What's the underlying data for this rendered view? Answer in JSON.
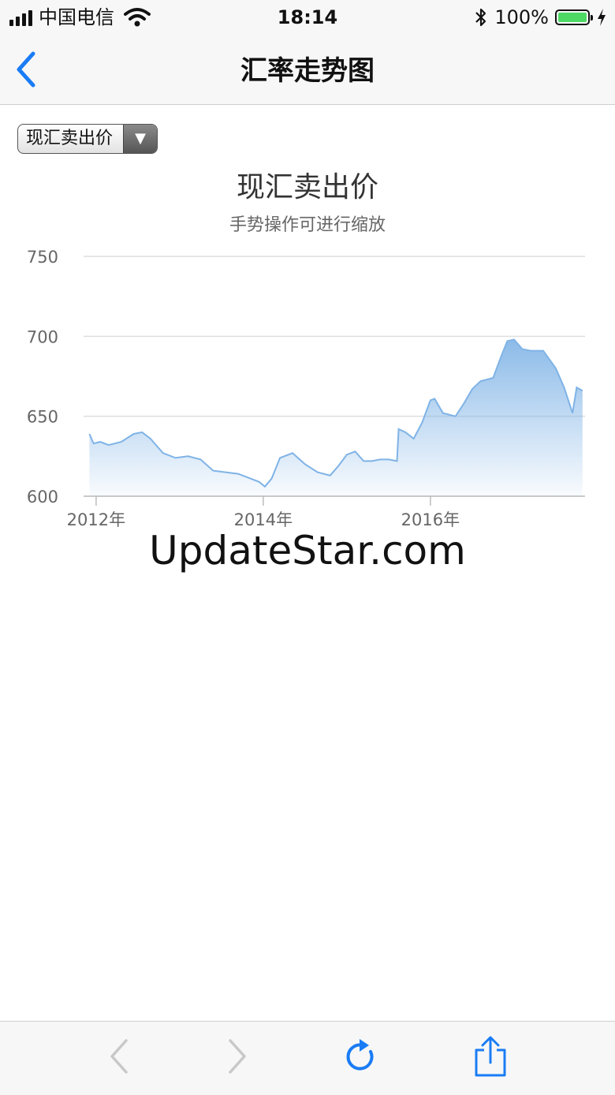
{
  "status_bar": {
    "carrier": "中国电信",
    "time": "18:14",
    "battery_percent": "100%",
    "battery_level": 1.0,
    "icons": [
      "signal-icon",
      "wifi-icon",
      "bluetooth-icon",
      "battery-icon",
      "charging-icon"
    ]
  },
  "nav": {
    "title": "汇率走势图",
    "back_icon": "chevron-left-icon",
    "accent": "#1a7cf5"
  },
  "dropdown": {
    "selected": "现汇卖出价",
    "arrow": "▼"
  },
  "chart_data": {
    "type": "area",
    "title": "现汇卖出价",
    "subtitle": "手势操作可进行缩放",
    "ylim": [
      600,
      750
    ],
    "yticks": [
      600,
      650,
      700,
      750
    ],
    "ytick_labels": [
      "600",
      "650",
      "700",
      "750"
    ],
    "xlim": [
      2011.85,
      2017.85
    ],
    "xticks": [
      2012,
      2014,
      2016
    ],
    "xtick_labels": [
      "2012年",
      "2014年",
      "2016年"
    ],
    "grid": true,
    "color": "#7fb3e6",
    "series": [
      {
        "x": [
          2011.92,
          2011.97,
          2012.05,
          2012.15,
          2012.3,
          2012.45,
          2012.55,
          2012.65,
          2012.8,
          2012.95,
          2013.1,
          2013.25,
          2013.4,
          2013.55,
          2013.7,
          2013.85,
          2013.95,
          2014.02,
          2014.1,
          2014.2,
          2014.35,
          2014.5,
          2014.65,
          2014.8,
          2014.9,
          2015.0,
          2015.1,
          2015.2,
          2015.3,
          2015.4,
          2015.5,
          2015.6,
          2015.62,
          2015.7,
          2015.8,
          2015.9,
          2016.0,
          2016.05,
          2016.15,
          2016.3,
          2016.4,
          2016.5,
          2016.6,
          2016.75,
          2016.85,
          2016.92,
          2017.0,
          2017.1,
          2017.2,
          2017.35,
          2017.5,
          2017.6,
          2017.65,
          2017.7,
          2017.75,
          2017.82
        ],
        "values": [
          639,
          633,
          634,
          632,
          634,
          639,
          640,
          636,
          627,
          624,
          625,
          623,
          616,
          615,
          614,
          611,
          609,
          606,
          611,
          624,
          627,
          620,
          615,
          613,
          619,
          626,
          628,
          622,
          622,
          623,
          623,
          622,
          642,
          640,
          636,
          646,
          660,
          661,
          652,
          650,
          658,
          667,
          672,
          674,
          688,
          697,
          698,
          692,
          691,
          691,
          680,
          668,
          660,
          652,
          668,
          666
        ]
      }
    ]
  },
  "watermark": "UpdateStar.com",
  "toolbar": {
    "items": [
      "back-arrow-icon",
      "forward-arrow-icon",
      "reload-icon",
      "share-icon"
    ],
    "disabled_color": "#c8c8c8",
    "active_color": "#1a7cf5"
  }
}
